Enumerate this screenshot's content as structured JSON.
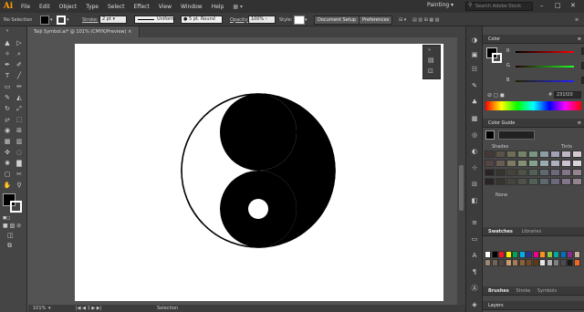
{
  "app": {
    "logo": "Ai",
    "menu": [
      "File",
      "Edit",
      "Object",
      "Type",
      "Select",
      "Effect",
      "View",
      "Window",
      "Help"
    ],
    "workspace": "Painting",
    "search_placeholder": "Search Adobe Stock"
  },
  "control_bar": {
    "selection_label": "No Selection",
    "stroke_label": "Stroke:",
    "stroke_weight": "2 pt",
    "profile": "Uniform",
    "brush": "5 pt. Round",
    "opacity_label": "Opacity:",
    "opacity_value": "100%",
    "style_label": "Style:",
    "document_setup": "Document Setup",
    "preferences": "Preferences"
  },
  "document": {
    "tab_title": "Taiji Symbol.ai* @ 101% (CMYK/Preview)",
    "close": "×"
  },
  "status": {
    "zoom": "101%",
    "page": "1",
    "tool": "Selection"
  },
  "color_panel": {
    "title": "Color",
    "r": "35",
    "g": "31",
    "b": "32",
    "hex": "231f20",
    "hex_label": "#"
  },
  "color_guide": {
    "title": "Color Guide",
    "left_label": "Shades",
    "right_label": "Tints",
    "footer": "None"
  },
  "swatches": {
    "tab1": "Swatches",
    "tab2": "Libraries"
  },
  "bottom_tabs": [
    "Brushes",
    "Stroke",
    "Symbols"
  ],
  "layers": {
    "title": "Layers"
  },
  "colors": {
    "menubar": "#323232",
    "panel": "#484848",
    "accent_logo": "#ff9a00",
    "fill": "#000000"
  }
}
